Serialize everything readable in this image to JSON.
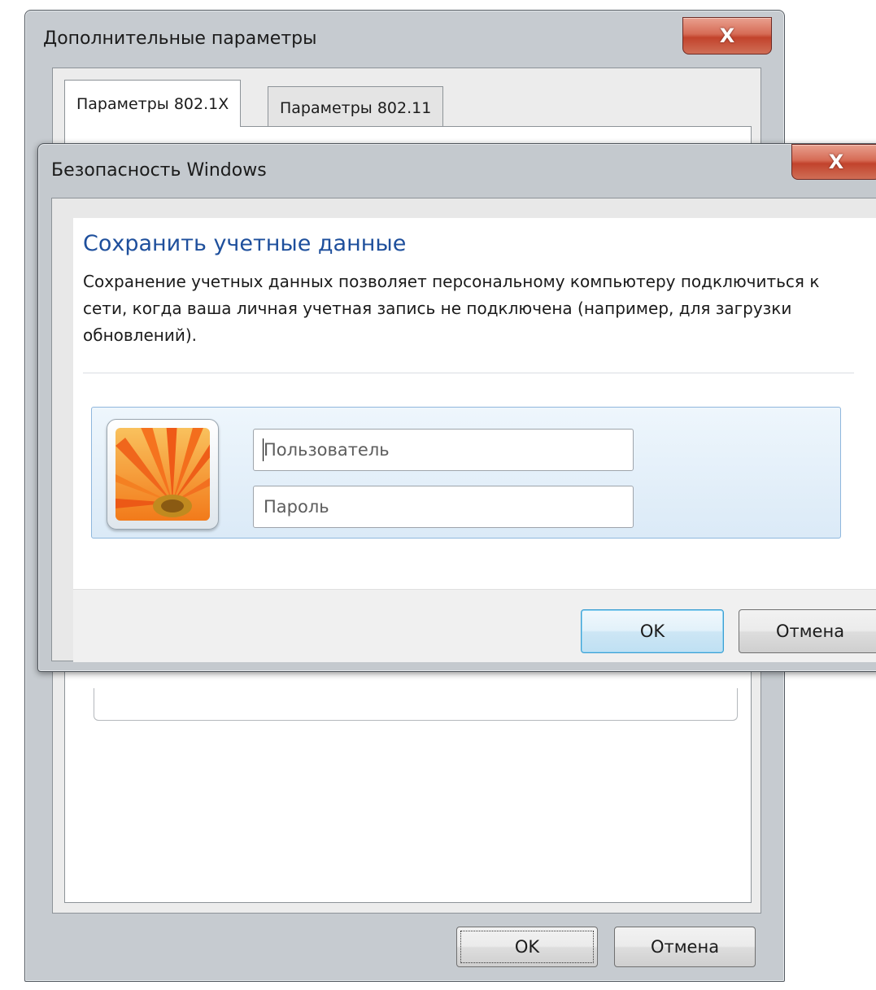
{
  "back_window": {
    "title": "Дополнительные параметры",
    "close_glyph": "X",
    "tabs": [
      {
        "label": "Параметры 802.1X",
        "active": true
      },
      {
        "label": "Параметры 802.11",
        "active": false
      }
    ],
    "buttons": {
      "ok": "OK",
      "cancel": "Отмена"
    }
  },
  "front_window": {
    "title": "Безопасность Windows",
    "close_glyph": "X",
    "heading": "Сохранить учетные данные",
    "description": "Сохранение учетных данных позволяет персональному компьютеру подключиться к сети, когда ваша личная учетная запись не подключена (например, для загрузки обновлений).",
    "fields": {
      "user_placeholder": "Пользователь",
      "password_placeholder": "Пароль"
    },
    "avatar_icon": "user-flower-icon",
    "buttons": {
      "ok": "OK",
      "cancel": "Отмена"
    }
  },
  "colors": {
    "heading": "#1e4f9c",
    "close_button": "#c2432c",
    "tile_border": "#8fb7dd",
    "default_button_border": "#3c9fd2"
  }
}
